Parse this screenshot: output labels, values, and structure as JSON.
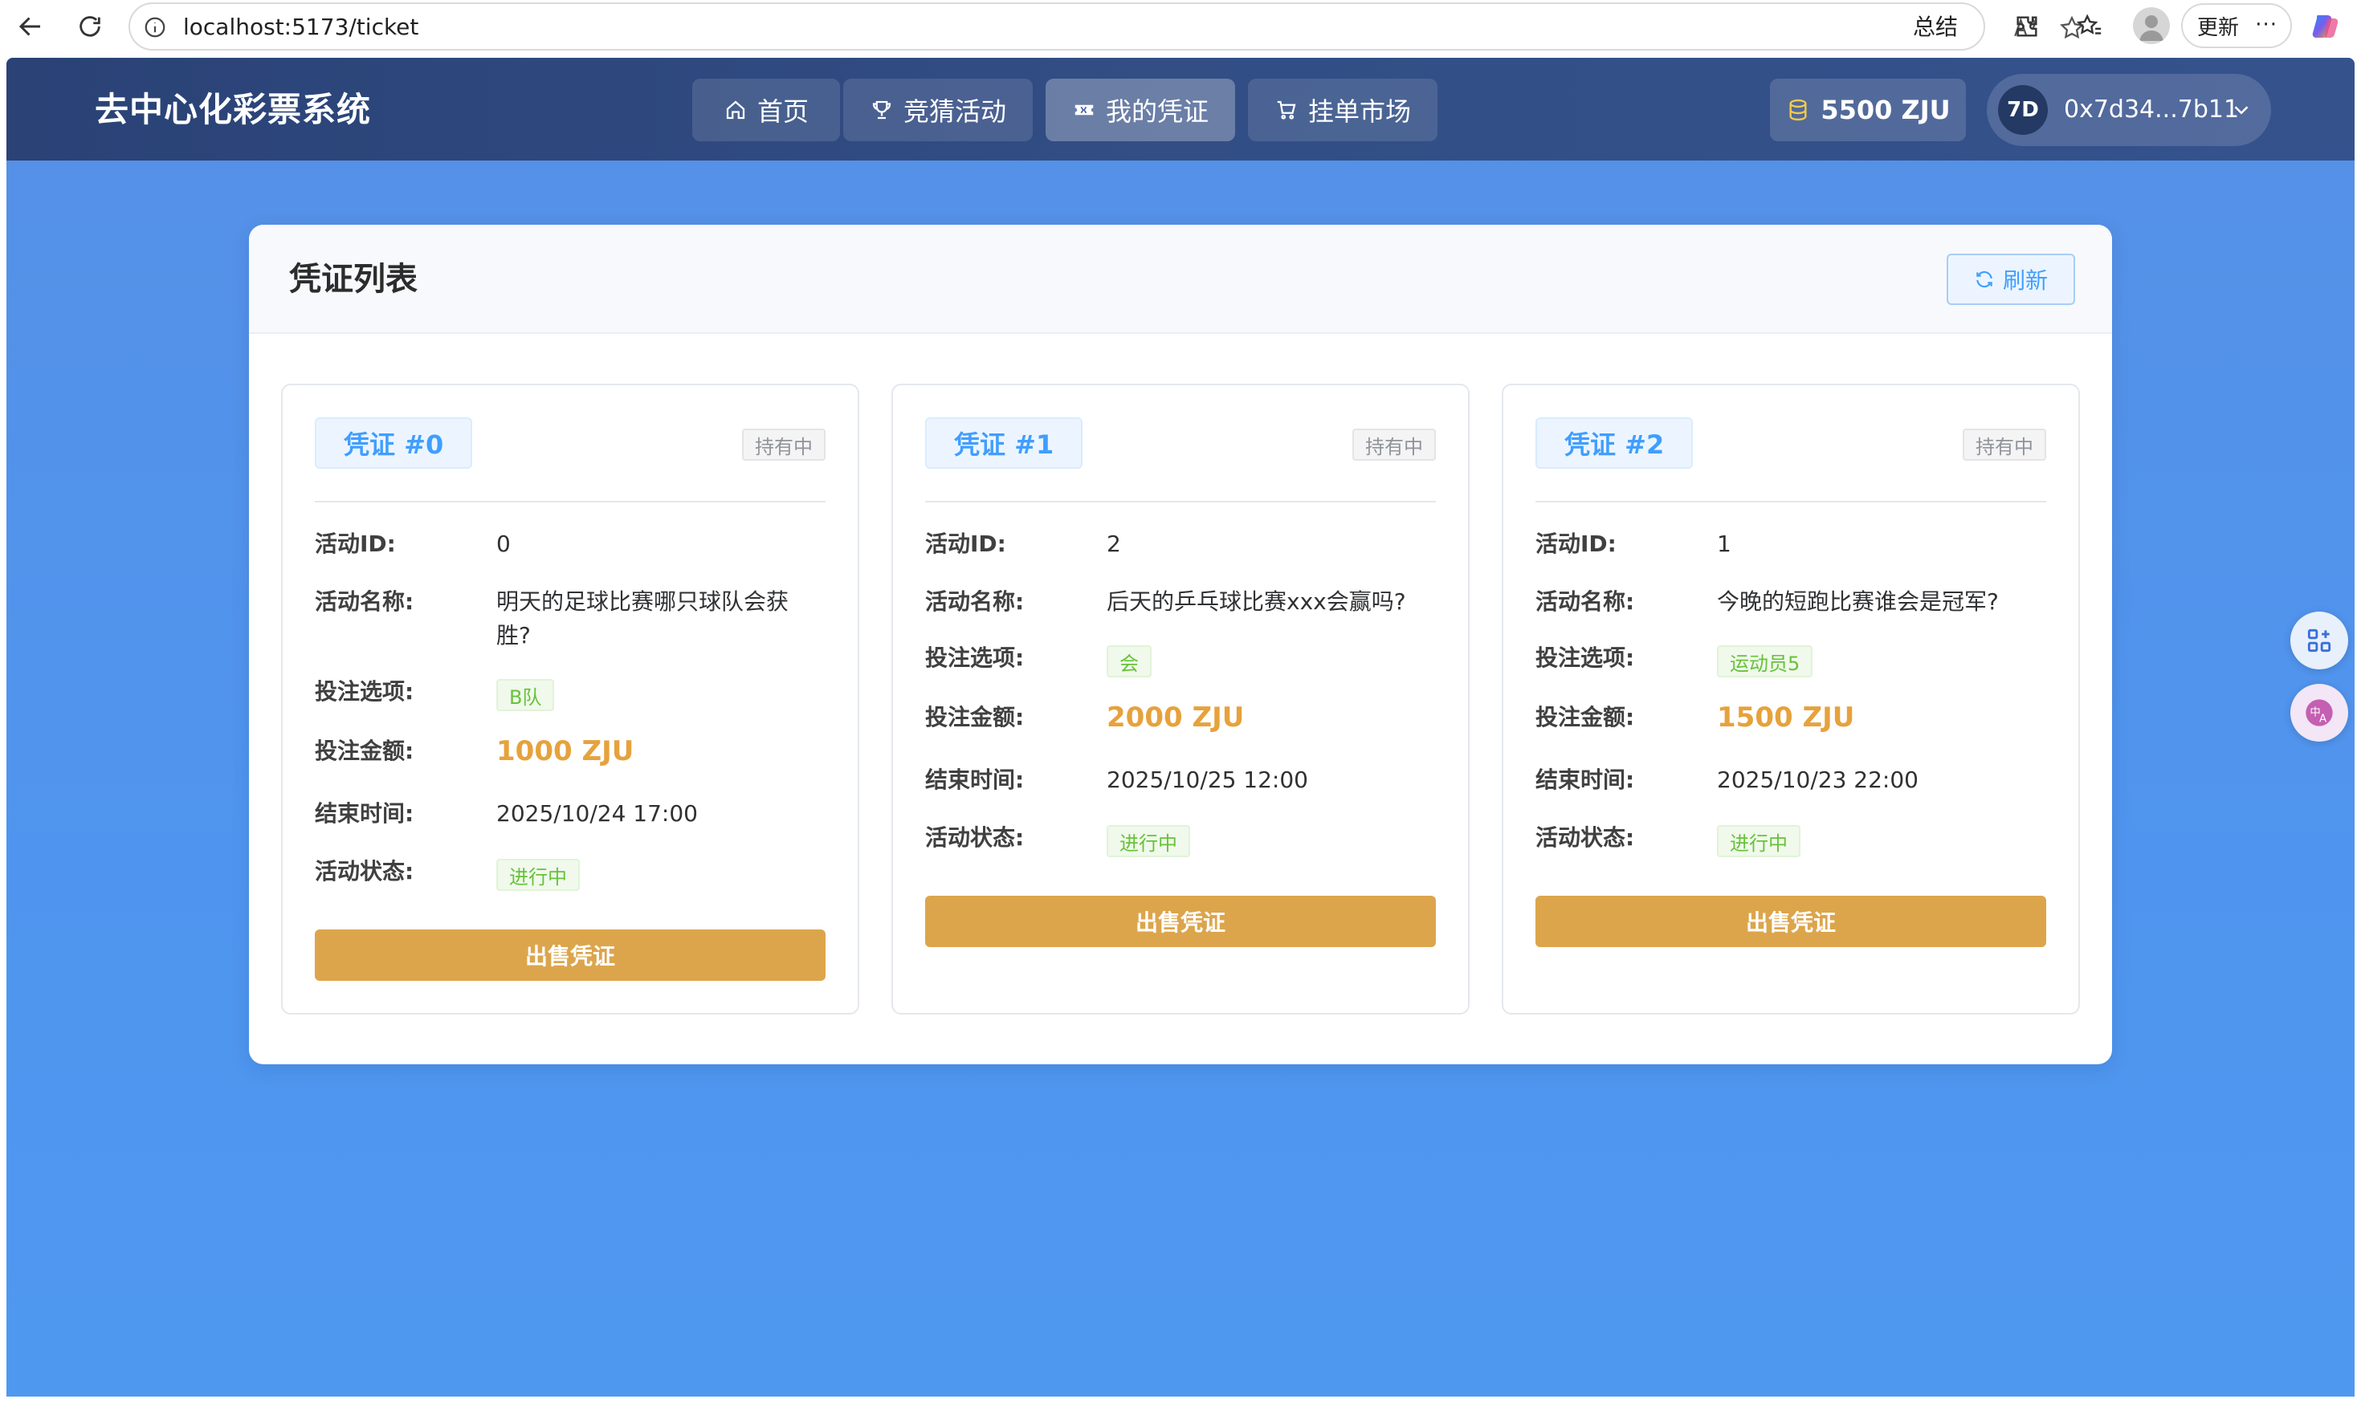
{
  "browser": {
    "url": "localhost:5173/ticket",
    "summary_label": "总结",
    "update_label": "更新",
    "more_label": "···"
  },
  "app": {
    "title": "去中心化彩票系统",
    "nav": [
      {
        "label": "首页",
        "icon": "home-icon",
        "active": false
      },
      {
        "label": "竞猜活动",
        "icon": "trophy-icon",
        "active": false
      },
      {
        "label": "我的凭证",
        "icon": "ticket-icon",
        "active": true
      },
      {
        "label": "挂单市场",
        "icon": "cart-icon",
        "active": false
      }
    ],
    "balance": "5500 ZJU",
    "account": {
      "avatar_text": "7D",
      "address": "0x7d34...7b11"
    }
  },
  "panel": {
    "title": "凭证列表",
    "refresh_label": "刷新"
  },
  "labels": {
    "activity_id": "活动ID:",
    "activity_name": "活动名称:",
    "bet_option": "投注选项:",
    "bet_amount": "投注金额:",
    "end_time": "结束时间:",
    "activity_status": "活动状态:",
    "sell_button": "出售凭证"
  },
  "tickets": [
    {
      "tag": "凭证 #0",
      "hold_status": "持有中",
      "activity_id": "0",
      "activity_name": "明天的足球比赛哪只球队会获胜?",
      "bet_option": "B队",
      "bet_amount": "1000 ZJU",
      "end_time": "2025/10/24 17:00",
      "activity_status": "进行中"
    },
    {
      "tag": "凭证 #1",
      "hold_status": "持有中",
      "activity_id": "2",
      "activity_name": "后天的乒乓球比赛xxx会赢吗?",
      "bet_option": "会",
      "bet_amount": "2000 ZJU",
      "end_time": "2025/10/25 12:00",
      "activity_status": "进行中"
    },
    {
      "tag": "凭证 #2",
      "hold_status": "持有中",
      "activity_id": "1",
      "activity_name": "今晚的短跑比赛谁会是冠军?",
      "bet_option": "运动员5",
      "bet_amount": "1500 ZJU",
      "end_time": "2025/10/23 22:00",
      "activity_status": "进行中"
    }
  ],
  "colors": {
    "header_bg": "#2f4a80",
    "page_bg": "#4f95ef",
    "primary": "#409eff",
    "amount": "#e6a23c",
    "sell_button": "#dca54c",
    "success": "#67c23a"
  }
}
